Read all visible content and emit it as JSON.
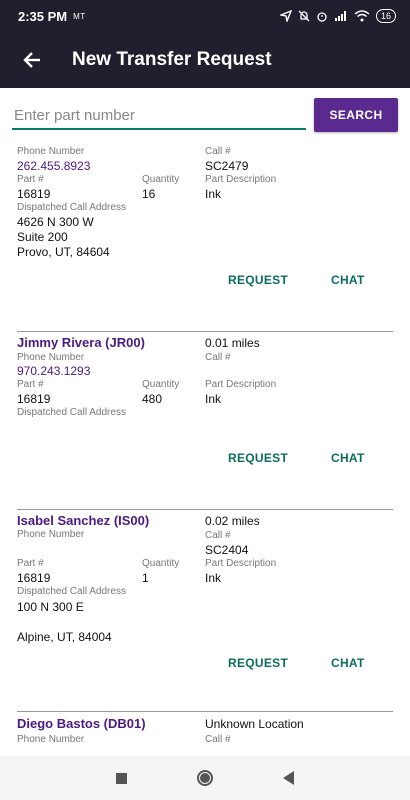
{
  "status_bar": {
    "time": "2:35 PM",
    "carrier": "MT",
    "battery": "16"
  },
  "app_bar": {
    "title": "New Transfer Request"
  },
  "search": {
    "placeholder": "Enter part number",
    "value": "",
    "button_label": "SEARCH"
  },
  "labels": {
    "phone": "Phone Number",
    "call": "Call #",
    "part": "Part #",
    "quantity": "Quantity",
    "part_description": "Part Description",
    "dispatched_address": "Dispatched Call Address",
    "request": "REQUEST",
    "chat": "CHAT"
  },
  "results": [
    {
      "phone": "262.455.8923",
      "call": "SC2479",
      "part": "16819",
      "quantity": "16",
      "description": "Ink",
      "address_line1": "4626 N 300 W",
      "address_line2": "Suite 200",
      "address_line3": "Provo, UT, 84604"
    },
    {
      "name": "Jimmy Rivera (JR00)",
      "distance": "0.01 miles",
      "phone": "970.243.1293",
      "call": "",
      "part": "16819",
      "quantity": "480",
      "description": "Ink"
    },
    {
      "name": "Isabel Sanchez (IS00)",
      "distance": "0.02 miles",
      "phone": "",
      "call": "SC2404",
      "part": "16819",
      "quantity": "1",
      "description": "Ink",
      "address_line1": "100 N 300 E",
      "address_line2": "",
      "address_line3": "Alpine, UT, 84004"
    },
    {
      "name": "Diego Bastos (DB01)",
      "distance": "Unknown Location"
    }
  ],
  "colors": {
    "app_bar": "#1f1f2e",
    "accent": "#5b2a91",
    "name": "#4a1a82",
    "action": "#0b6d5e"
  }
}
